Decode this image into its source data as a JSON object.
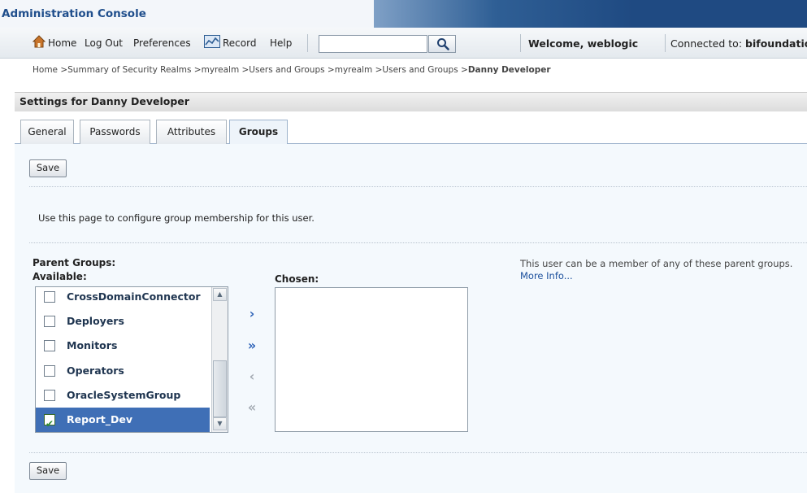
{
  "app": {
    "title": "Administration Console"
  },
  "toolbar": {
    "home": "Home",
    "logout": "Log Out",
    "preferences": "Preferences",
    "record": "Record",
    "help": "Help",
    "search_value": "",
    "welcome": "Welcome, weblogic",
    "connected_label": "Connected to:",
    "connected_value": "bifoundation"
  },
  "breadcrumb": {
    "path": "Home >Summary of Security Realms >myrealm >Users and Groups >myrealm >Users and Groups >",
    "current": "Danny Developer"
  },
  "settings": {
    "title": "Settings for Danny Developer"
  },
  "tabs": [
    {
      "label": "General",
      "active": false
    },
    {
      "label": "Passwords",
      "active": false
    },
    {
      "label": "Attributes",
      "active": false
    },
    {
      "label": "Groups",
      "active": true
    }
  ],
  "buttons": {
    "save": "Save"
  },
  "description": "Use this page to configure group membership for this user.",
  "groups": {
    "parent_label": "Parent Groups:",
    "available_label": "Available:",
    "chosen_label": "Chosen:",
    "available": [
      {
        "label": "CrossDomainConnector",
        "checked": false,
        "selected": false
      },
      {
        "label": "Deployers",
        "checked": false,
        "selected": false
      },
      {
        "label": "Monitors",
        "checked": false,
        "selected": false
      },
      {
        "label": "Operators",
        "checked": false,
        "selected": false
      },
      {
        "label": "OracleSystemGroup",
        "checked": false,
        "selected": false
      },
      {
        "label": "Report_Dev",
        "checked": true,
        "selected": true
      }
    ],
    "chosen": []
  },
  "help": {
    "text": "This user can be a member of any of these parent groups.",
    "link": "More Info..."
  },
  "colors": {
    "accent": "#3f6fb6",
    "header_dark": "#1f4a82",
    "link": "#1a4f9c"
  }
}
